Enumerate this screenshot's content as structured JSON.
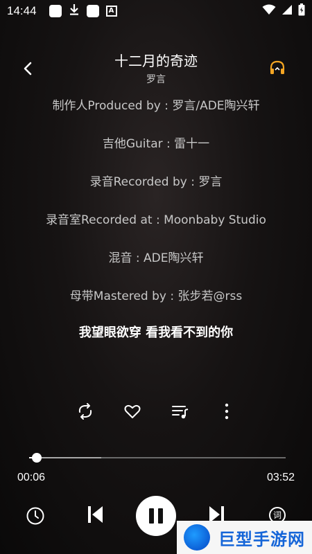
{
  "status_bar": {
    "time": "14:44",
    "icons": [
      "notification-square-icon",
      "download-icon",
      "notification-square-icon",
      "a-box-icon",
      "wifi-icon",
      "signal-icon",
      "battery-icon"
    ]
  },
  "header": {
    "title": "十二月的奇迹",
    "artist": "罗言"
  },
  "lyrics": {
    "lines": [
      "制作人Produced by : 罗言/ADE陶兴轩",
      "吉他Guitar : 雷十一",
      "录音Recorded by : 罗言",
      "录音室Recorded at : Moonbaby Studio",
      "混音 : ADE陶兴轩",
      "母带Mastered by : 张步若@rss",
      "我望眼欲穿 看我看不到的你"
    ],
    "current_index": 6
  },
  "actions": [
    "repeat-icon",
    "heart-icon",
    "playlist-icon",
    "more-icon"
  ],
  "player": {
    "elapsed": "00:06",
    "duration": "03:52",
    "progress_fraction": 0.03,
    "buffered_fraction": 0.28
  },
  "controls": {
    "lyric_toggle_label": "词"
  },
  "watermark": {
    "text": "巨型手游网"
  },
  "colors": {
    "accent": "#ffffff",
    "headphone": "#f5a623",
    "watermark_blue": "#1565d8"
  }
}
